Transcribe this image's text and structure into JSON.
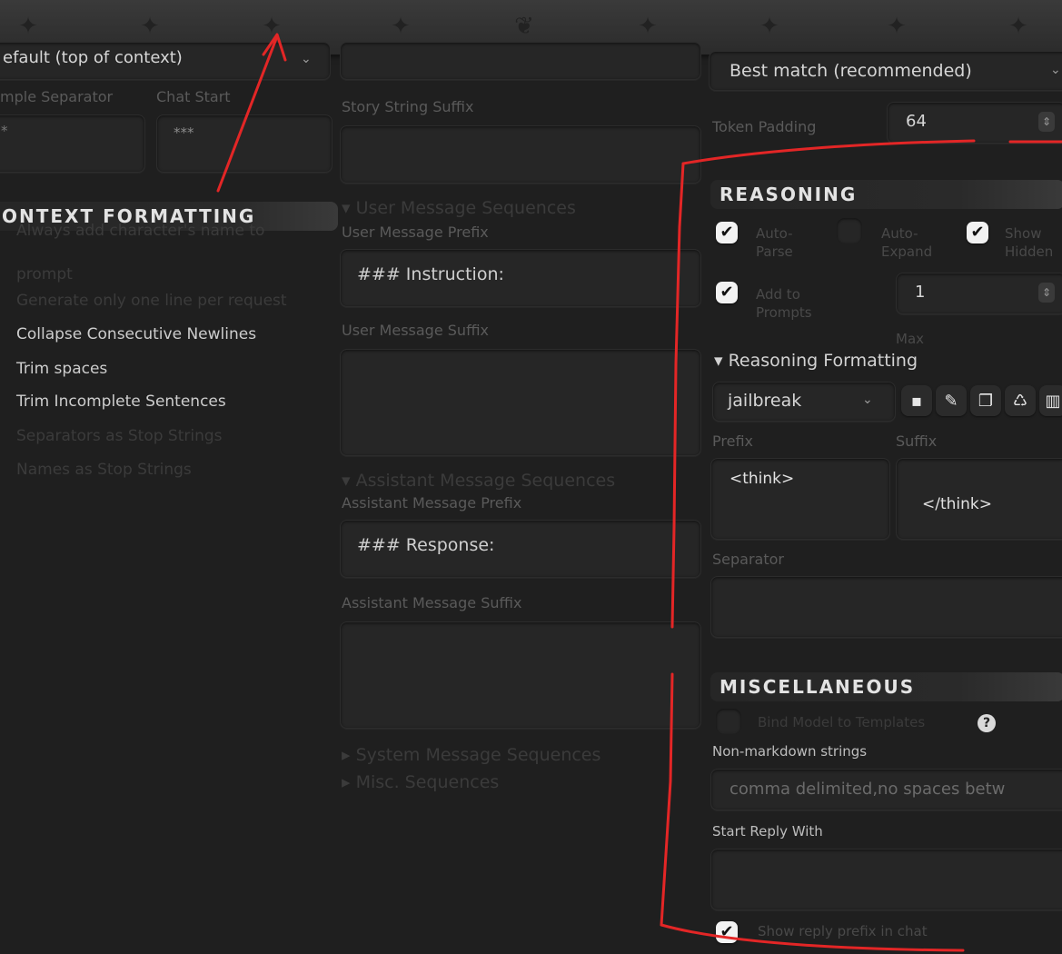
{
  "topbar": {
    "icons": [
      "nav-icon-1",
      "nav-icon-2",
      "nav-icon-3",
      "nav-icon-4",
      "butterfly-icon",
      "nav-icon-6",
      "nav-icon-7",
      "nav-icon-8",
      "nav-icon-9"
    ]
  },
  "left": {
    "position_select": "efault (top of context)",
    "example_separator_label": "mple Separator",
    "chat_start_label": "Chat Start",
    "example_separator_value": "*",
    "chat_start_value": "***",
    "context_formatting_title": "ONTEXT FORMATTING",
    "options": [
      "Always add character's name to",
      "prompt",
      "Generate only one line per request",
      "Collapse Consecutive Newlines",
      "Trim spaces",
      "Trim Incomplete Sentences",
      "Separators as Stop Strings",
      "Names as Stop Strings"
    ]
  },
  "middle": {
    "story_string_suffix_label": "Story String Suffix",
    "user_seq_header": "User Message Sequences",
    "user_prefix_label": "User Message Prefix",
    "user_prefix_value": "### Instruction:",
    "user_suffix_label": "User Message Suffix",
    "assistant_seq_header": "Assistant Message Sequences",
    "assistant_prefix_label": "Assistant Message Prefix",
    "assistant_prefix_value": "### Response:",
    "assistant_suffix_label": "Assistant Message Suffix",
    "system_seq_header": "System Message Sequences",
    "misc_seq_header": "Misc. Sequences"
  },
  "right": {
    "tokenizer_select": "Best match (recommended)",
    "token_padding_label": "Token Padding",
    "token_padding_value": "64",
    "reasoning_title": "REASONING",
    "auto_parse": "Auto-\nParse",
    "auto_expand": "Auto-\nExpand",
    "show_hidden": "Show\nHidden",
    "add_to_prompts": "Add to\nPrompts",
    "max_value": "1",
    "max_label": "Max",
    "reasoning_formatting": "Reasoning Formatting",
    "preset_select": "jailbreak",
    "prefix_label": "Prefix",
    "suffix_label": "Suffix",
    "prefix_value": "<think>",
    "suffix_value": "</think>",
    "separator_label": "Separator",
    "misc_title": "MISCELLANEOUS",
    "bind_model": "Bind Model to Templates",
    "non_markdown_label": "Non-markdown strings",
    "non_markdown_placeholder": "comma delimited,no spaces betw",
    "start_reply_label": "Start Reply With",
    "show_reply_prefix": "Show reply prefix in chat"
  },
  "colors": {
    "background": "#1f1f1f",
    "annotation_red": "#e32626"
  }
}
